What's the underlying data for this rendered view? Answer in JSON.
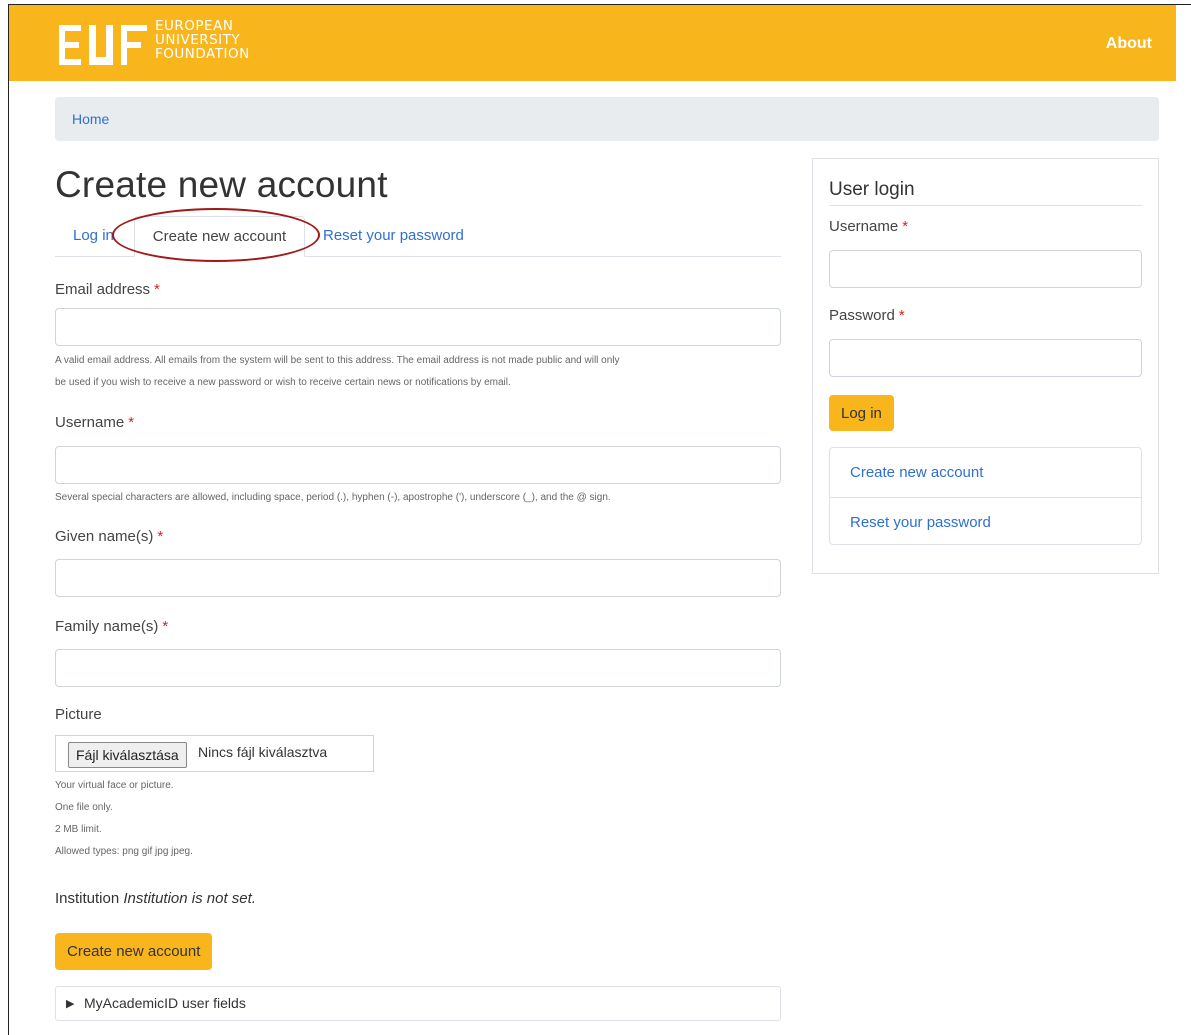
{
  "header": {
    "logo_letters": "EUF",
    "logo_lines": [
      "EUROPEAN",
      "UNIVERSITY",
      "FOUNDATION"
    ],
    "nav_about": "About",
    "brand_color": "#f8b51c"
  },
  "breadcrumb": {
    "home": "Home"
  },
  "main": {
    "title": "Create new account",
    "tabs": [
      {
        "label": "Log in",
        "active": false
      },
      {
        "label": "Create new account",
        "active": true
      },
      {
        "label": "Reset your password",
        "active": false
      }
    ],
    "form": {
      "email": {
        "label": "Email address",
        "required_mark": "*",
        "value": "",
        "help_line1": "A valid email address. All emails from the system will be sent to this address. The email address is not made public and will only",
        "help_line2": "be used if you wish to receive a new password or wish to receive certain news or notifications by email."
      },
      "username": {
        "label": "Username",
        "required_mark": "*",
        "value": "",
        "help": "Several special characters are allowed, including space, period (.), hyphen (-), apostrophe ('), underscore (_), and the @ sign."
      },
      "given_name": {
        "label": "Given name(s)",
        "required_mark": "*",
        "value": ""
      },
      "family_name": {
        "label": "Family name(s)",
        "required_mark": "*",
        "value": ""
      },
      "picture": {
        "label": "Picture",
        "button": "Fájl kiválasztása",
        "status": "Nincs fájl kiválasztva",
        "help": [
          "Your virtual face or picture.",
          "One file only.",
          "2 MB limit.",
          "Allowed types: png gif jpg jpeg."
        ]
      },
      "institution": {
        "label": "Institution",
        "value": "Institution is not set."
      },
      "submit": "Create new account",
      "details_summary": "MyAcademicID user fields",
      "details_marker": "▶"
    }
  },
  "sidebar": {
    "title": "User login",
    "username_label": "Username",
    "password_label": "Password",
    "required_mark": "*",
    "login_button": "Log in",
    "links": [
      "Create new account",
      "Reset your password"
    ]
  }
}
